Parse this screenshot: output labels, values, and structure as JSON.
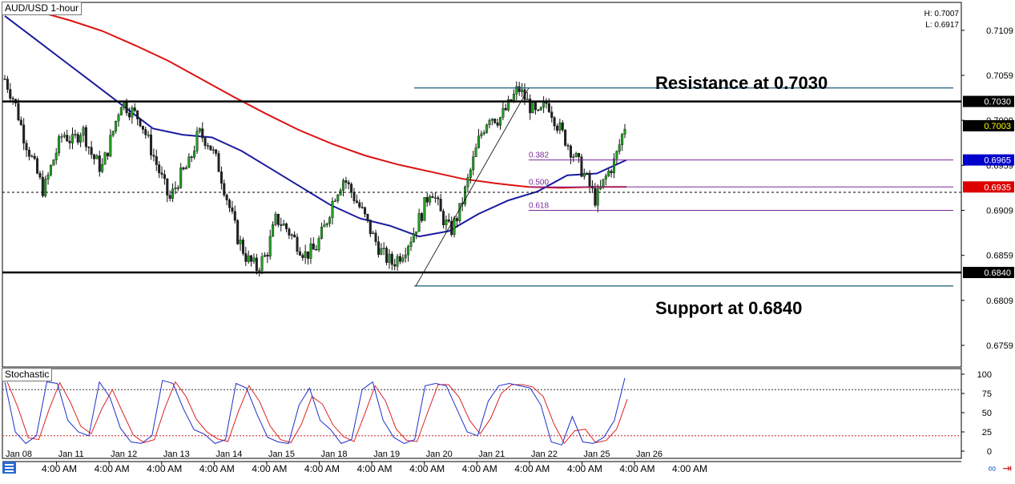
{
  "title": "AUD/USD 1-hour",
  "high_label": "H: 0.7007",
  "low_label": "L: 0.6917",
  "indicator_label": "Stochastic",
  "annotations": {
    "resistance": "Resistance at 0.7030",
    "support": "Support at 0.6840"
  },
  "fib_labels": [
    "0.382",
    "0.500",
    "0.618"
  ],
  "price_ticks": [
    "0.7109",
    "0.7059",
    "0.7009",
    "0.6959",
    "0.6909",
    "0.6859",
    "0.6809",
    "0.6759"
  ],
  "stoch_ticks": [
    "100",
    "75",
    "50",
    "25",
    "0"
  ],
  "price_tags": [
    {
      "value": "0.7030",
      "bg": "#000000",
      "fg": "#ffffff"
    },
    {
      "value": "0.7003",
      "bg": "#000000",
      "fg": "#ffff00"
    },
    {
      "value": "0.6965",
      "bg": "#0000cc",
      "fg": "#ffffff"
    },
    {
      "value": "0.6935",
      "bg": "#dd0000",
      "fg": "#ffffff"
    },
    {
      "value": "0.6840",
      "bg": "#000000",
      "fg": "#ffffff"
    }
  ],
  "date_labels": [
    "Jan 08",
    "Jan 11",
    "Jan 12",
    "Jan 13",
    "Jan 14",
    "Jan 15",
    "Jan 18",
    "Jan 19",
    "Jan 20",
    "Jan 21",
    "Jan 22",
    "Jan 25",
    "Jan 26"
  ],
  "time_labels": [
    "4:00 AM",
    "4:00 AM",
    "4:00 AM",
    "4:00 AM",
    "4:00 AM",
    "4:00 AM",
    "4:00 AM",
    "4:00 AM",
    "4:00 AM",
    "4:00 AM",
    "4:00 AM",
    "4:00 AM",
    "4:00 AM"
  ],
  "colors": {
    "candle_up": "#20a020",
    "candle_down": "#222222",
    "ma_fast": "#1a1aa0",
    "ma_slow": "#dd1111",
    "fib": "#7a2a9a",
    "hline": "#000000",
    "channel": "#1a5a7a",
    "stoch_k": "#2030cc",
    "stoch_d": "#dd2222"
  },
  "chart_data": {
    "type": "candlestick",
    "symbol": "AUD/USD",
    "timeframe": "1-hour",
    "ylim": [
      0.6735,
      0.714
    ],
    "x": [
      "Jan 08",
      "Jan 11",
      "Jan 12",
      "Jan 13",
      "Jan 14",
      "Jan 15",
      "Jan 18",
      "Jan 19",
      "Jan 20",
      "Jan 21",
      "Jan 22",
      "Jan 25",
      "Jan 26"
    ],
    "close_path": [
      0.7055,
      0.703,
      0.699,
      0.696,
      0.693,
      0.6965,
      0.6995,
      0.6985,
      0.7,
      0.697,
      0.6955,
      0.699,
      0.703,
      0.702,
      0.701,
      0.698,
      0.695,
      0.692,
      0.6945,
      0.696,
      0.6995,
      0.6985,
      0.696,
      0.692,
      0.688,
      0.6855,
      0.6845,
      0.686,
      0.69,
      0.689,
      0.6875,
      0.686,
      0.6865,
      0.689,
      0.6925,
      0.6945,
      0.6925,
      0.6905,
      0.688,
      0.686,
      0.685,
      0.6862,
      0.688,
      0.6905,
      0.6935,
      0.6905,
      0.6885,
      0.691,
      0.695,
      0.699,
      0.7015,
      0.701,
      0.7025,
      0.7045,
      0.7028,
      0.7012,
      0.703,
      0.7005,
      0.6985,
      0.6965,
      0.6945,
      0.692,
      0.6945,
      0.6965,
      0.7003
    ],
    "ma_slow": [
      0.7135,
      0.713,
      0.712,
      0.7108,
      0.7092,
      0.7075,
      0.7055,
      0.7035,
      0.7016,
      0.6998,
      0.6983,
      0.697,
      0.696,
      0.6952,
      0.6944,
      0.6939,
      0.6935,
      0.6934,
      0.6935,
      0.6935
    ],
    "ma_fast": [
      0.7125,
      0.71,
      0.7075,
      0.705,
      0.7025,
      0.7,
      0.6993,
      0.699,
      0.6975,
      0.6955,
      0.6935,
      0.6915,
      0.69,
      0.6892,
      0.688,
      0.6886,
      0.6905,
      0.692,
      0.693,
      0.6948,
      0.695,
      0.6965
    ],
    "horizontal_levels": [
      {
        "value": 0.703,
        "label": "Resistance at 0.7030"
      },
      {
        "value": 0.684,
        "label": "Support at 0.6840"
      }
    ],
    "channel_lines": [
      0.7045,
      0.6825
    ],
    "dashed_level": 0.6929,
    "fibonacci": {
      "swing_low": 0.6825,
      "swing_high": 0.7045,
      "levels": [
        {
          "ratio": 0.382,
          "value": 0.6965
        },
        {
          "ratio": 0.5,
          "value": 0.6935
        },
        {
          "ratio": 0.618,
          "value": 0.6909
        }
      ]
    },
    "stochastic": {
      "ylim": [
        0,
        100
      ],
      "levels": [
        80,
        20
      ],
      "k": [
        90,
        25,
        10,
        20,
        90,
        88,
        40,
        25,
        20,
        90,
        70,
        30,
        12,
        10,
        20,
        92,
        88,
        55,
        28,
        22,
        10,
        15,
        88,
        82,
        48,
        18,
        12,
        10,
        60,
        82,
        40,
        28,
        10,
        15,
        80,
        90,
        40,
        18,
        10,
        15,
        85,
        88,
        85,
        55,
        25,
        20,
        65,
        85,
        88,
        85,
        82,
        60,
        12,
        8,
        45,
        12,
        10,
        18,
        40,
        95
      ]
    }
  }
}
